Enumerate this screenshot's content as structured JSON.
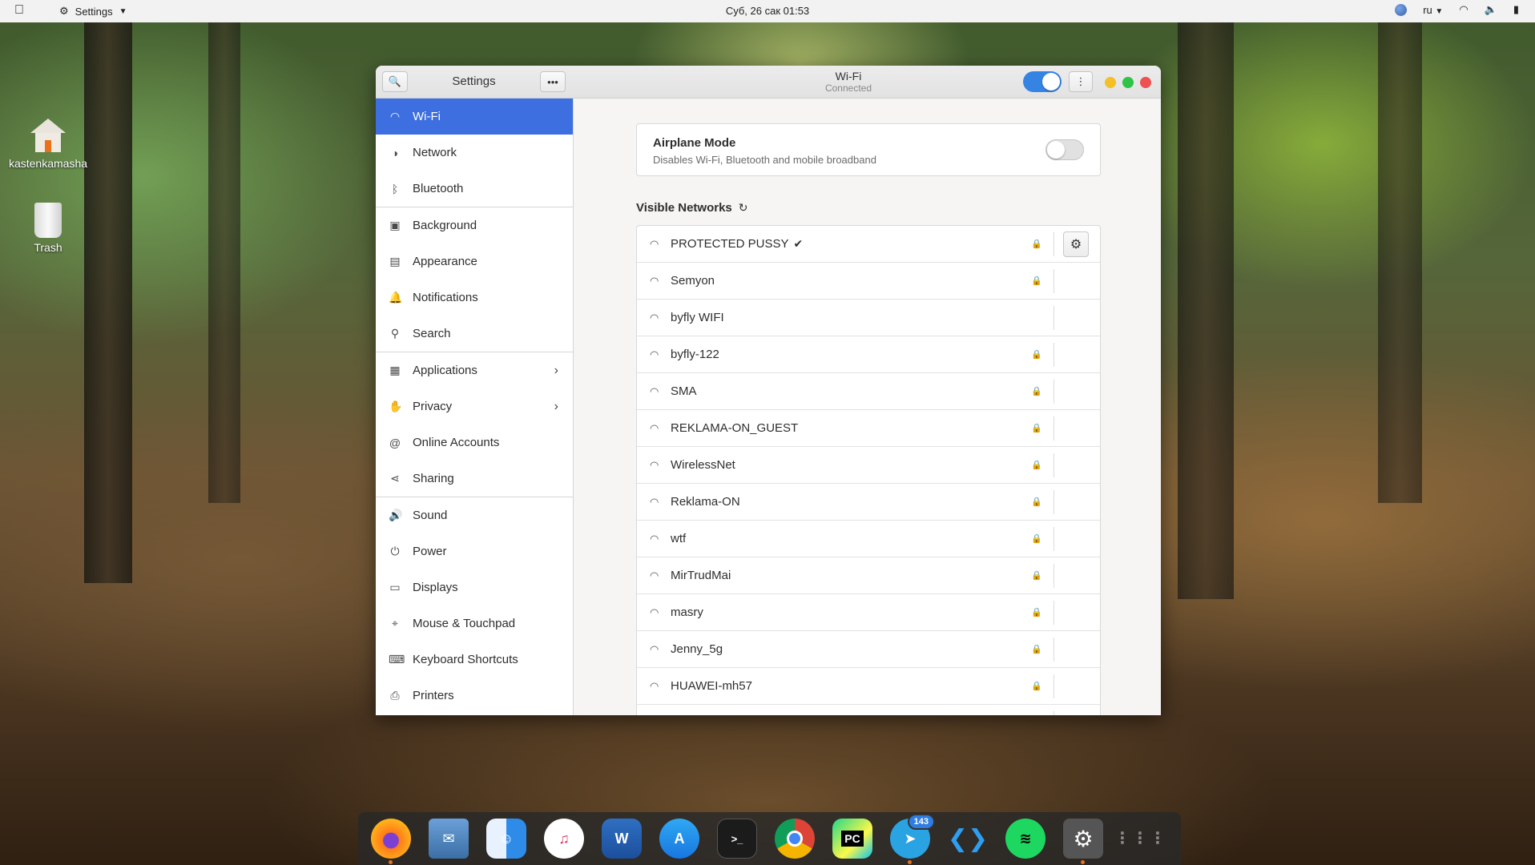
{
  "topbar": {
    "app_name": "Settings",
    "clock": "Суб, 26 сак  01:53",
    "lang": "ru"
  },
  "desktop": {
    "icons": [
      {
        "label": "kastenkamasha",
        "icon": "home-folder-icon"
      },
      {
        "label": "Trash",
        "icon": "trash-icon"
      }
    ]
  },
  "window": {
    "sidebar_title": "Settings",
    "title": "Wi-Fi",
    "subtitle": "Connected",
    "wifi_enabled": true
  },
  "sidebar": {
    "items": [
      {
        "label": "Wi-Fi",
        "icon": "wifi-icon",
        "active": true
      },
      {
        "label": "Network",
        "icon": "network-icon"
      },
      {
        "label": "Bluetooth",
        "icon": "bluetooth-icon"
      },
      {
        "label": "Background",
        "icon": "background-icon"
      },
      {
        "label": "Appearance",
        "icon": "appearance-icon"
      },
      {
        "label": "Notifications",
        "icon": "bell-icon"
      },
      {
        "label": "Search",
        "icon": "search-icon"
      },
      {
        "label": "Applications",
        "icon": "applications-icon"
      },
      {
        "label": "Privacy",
        "icon": "hand-icon"
      },
      {
        "label": "Online Accounts",
        "icon": "at-icon"
      },
      {
        "label": "Sharing",
        "icon": "share-icon"
      },
      {
        "label": "Sound",
        "icon": "speaker-icon"
      },
      {
        "label": "Power",
        "icon": "power-icon"
      },
      {
        "label": "Displays",
        "icon": "display-icon"
      },
      {
        "label": "Mouse & Touchpad",
        "icon": "mouse-icon"
      },
      {
        "label": "Keyboard Shortcuts",
        "icon": "keyboard-icon"
      },
      {
        "label": "Printers",
        "icon": "printer-icon"
      }
    ]
  },
  "airplane": {
    "title": "Airplane Mode",
    "description": "Disables Wi-Fi, Bluetooth and mobile broadband",
    "enabled": false
  },
  "networks": {
    "label": "Visible Networks",
    "items": [
      {
        "name": "PROTECTED PUSSY",
        "secured": true,
        "connected": true
      },
      {
        "name": "Semyon",
        "secured": true
      },
      {
        "name": "byfly WIFI",
        "secured": false
      },
      {
        "name": "byfly-122",
        "secured": true
      },
      {
        "name": "SMA",
        "secured": true
      },
      {
        "name": "REKLAMA-ON_GUEST",
        "secured": true
      },
      {
        "name": "WirelessNet",
        "secured": true
      },
      {
        "name": "Reklama-ON",
        "secured": true
      },
      {
        "name": "wtf",
        "secured": true
      },
      {
        "name": "MirTrudMai",
        "secured": true
      },
      {
        "name": "masry",
        "secured": true
      },
      {
        "name": "Jenny_5g",
        "secured": true
      },
      {
        "name": "HUAWEI-mh57",
        "secured": true
      }
    ]
  },
  "dock": {
    "items": [
      {
        "name": "firefox",
        "icon": "firefox-icon",
        "running": true
      },
      {
        "name": "mail",
        "icon": "mail-icon"
      },
      {
        "name": "finder",
        "icon": "finder-icon"
      },
      {
        "name": "music",
        "icon": "music-icon"
      },
      {
        "name": "writer",
        "icon": "word-icon",
        "text": "W"
      },
      {
        "name": "app-store",
        "icon": "app-store-icon"
      },
      {
        "name": "terminal",
        "icon": "terminal-icon",
        "text": ">_"
      },
      {
        "name": "chrome",
        "icon": "chrome-icon"
      },
      {
        "name": "pycharm",
        "icon": "pycharm-icon",
        "text": "PC"
      },
      {
        "name": "telegram",
        "icon": "telegram-icon",
        "badge": "143",
        "running": true
      },
      {
        "name": "vscode",
        "icon": "vscode-icon"
      },
      {
        "name": "spotify",
        "icon": "spotify-icon"
      },
      {
        "name": "settings",
        "icon": "settings-icon",
        "running": true
      },
      {
        "name": "app-grid",
        "icon": "app-grid-icon"
      }
    ]
  }
}
